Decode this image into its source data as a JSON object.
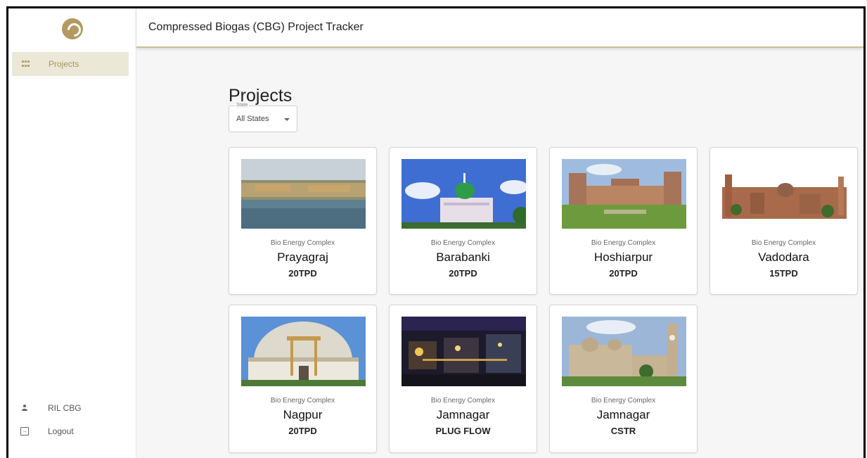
{
  "app": {
    "title": "Compressed Biogas (CBG) Project Tracker",
    "accent": "#b49a61"
  },
  "sidebar": {
    "logo_icon": "reliance-logo-icon",
    "items": [
      {
        "label": "Projects",
        "icon": "grid-icon",
        "active": true
      }
    ],
    "bottom": {
      "user_label": "RIL CBG",
      "logout_label": "Logout"
    }
  },
  "main": {
    "heading": "Projects",
    "state_filter": {
      "legend": "State",
      "value": "All States"
    },
    "cards": [
      {
        "category": "Bio Energy Complex",
        "city": "Prayagraj",
        "capacity": "20TPD",
        "image": "river-fort-image"
      },
      {
        "category": "Bio Energy Complex",
        "city": "Barabanki",
        "capacity": "20TPD",
        "image": "dargah-image"
      },
      {
        "category": "Bio Energy Complex",
        "city": "Hoshiarpur",
        "capacity": "20TPD",
        "image": "palace-lawn-image"
      },
      {
        "category": "Bio Energy Complex",
        "city": "Vadodara",
        "capacity": "15TPD",
        "image": "palace-skyline-image"
      },
      {
        "category": "Bio Energy Complex",
        "city": "Nagpur",
        "capacity": "20TPD",
        "image": "dome-stupa-image"
      },
      {
        "category": "Bio Energy Complex",
        "city": "Jamnagar",
        "capacity": "PLUG FLOW",
        "image": "refinery-night-image"
      },
      {
        "category": "Bio Energy Complex",
        "city": "Jamnagar",
        "capacity": "CSTR",
        "image": "clock-tower-palace-image"
      }
    ]
  }
}
